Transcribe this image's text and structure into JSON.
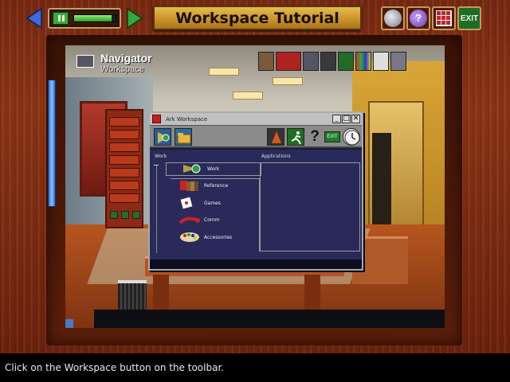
{
  "app": {
    "title": "Workspace Tutorial"
  },
  "top_bar": {
    "back_icon": "back-arrow-icon",
    "forward_icon": "forward-arrow-icon",
    "pause_icon": "pause-icon",
    "progress_fraction": 0.9,
    "right_buttons": [
      "clock-icon",
      "help-icon",
      "grid-icon",
      "exit-icon"
    ],
    "exit_label": "EXIT"
  },
  "navigator": {
    "title": "Navigator",
    "subtitle": "Workspace",
    "tools": [
      "door-icon",
      "card-icon",
      "phone-icon",
      "picture-icon",
      "runner-icon",
      "palette-icon",
      "tray-icon",
      "desk-icon"
    ]
  },
  "workspace_window": {
    "title": "Ark Workspace",
    "controls": [
      "_",
      "□",
      "✕"
    ],
    "toolbar": {
      "workspace_icon": "workspace-icon",
      "folder_icon": "folder-icon",
      "lamp_icon": "lamp-icon",
      "run_icon": "runner-icon",
      "help_label": "?",
      "exit_label": "EXIT",
      "clock_icon": "clock-icon"
    },
    "left_column_header": "Work",
    "right_column_header": "Applications",
    "tree": [
      {
        "label": "Work",
        "icon": "work-icon"
      },
      {
        "label": "Reference",
        "icon": "books-icon"
      },
      {
        "label": "Games",
        "icon": "dice-icon"
      },
      {
        "label": "Comm",
        "icon": "telephone-icon"
      },
      {
        "label": "Accessories",
        "icon": "palette-icon"
      }
    ]
  },
  "colors": {
    "wood": "#8e3616",
    "title_plate": "#d4a23a",
    "window_body": "#2a2a5a"
  },
  "caption": "Click on the Workspace button on the toolbar."
}
